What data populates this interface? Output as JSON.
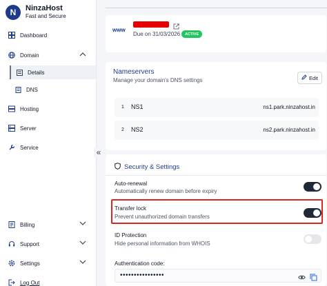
{
  "brand": {
    "logo_letter": "N",
    "name": "NinzaHost",
    "tagline": "Fast and Secure"
  },
  "sidebar": {
    "items": [
      {
        "label": "Dashboard"
      },
      {
        "label": "Domain"
      },
      {
        "label": "Hosting"
      },
      {
        "label": "Server"
      },
      {
        "label": "Service"
      },
      {
        "label": "Billing"
      },
      {
        "label": "Support"
      },
      {
        "label": "Settings"
      },
      {
        "label": "Log Out"
      }
    ],
    "domain_sub": [
      {
        "label": "Details"
      },
      {
        "label": "DNS"
      }
    ],
    "collapse_glyph": "«"
  },
  "domain": {
    "prefix": "www",
    "due": "Due on 31/03/2026",
    "status": "ACTIVE"
  },
  "nameservers": {
    "title": "Nameservers",
    "subtitle": "Manage your domain's DNS settings",
    "edit_label": "Edit",
    "rows": [
      {
        "num": "1",
        "label": "NS1",
        "value": "ns1.park.ninzahost.in"
      },
      {
        "num": "2",
        "label": "NS2",
        "value": "ns2.park.ninzahost.in"
      }
    ]
  },
  "security": {
    "title": "Security & Settings",
    "settings": [
      {
        "label": "Auto-renewal",
        "desc": "Automatically renew domain before expiry",
        "enabled": true
      },
      {
        "label": "Transfer lock",
        "desc": "Prevent unauthorized domain transfers",
        "enabled": true
      },
      {
        "label": "ID Protection",
        "desc": "Hide personal information from WHOIS",
        "enabled": false
      }
    ],
    "auth_label": "Authentication code:",
    "auth_masked": "••••••••••••••••"
  },
  "colors": {
    "brand": "#1e3a8a",
    "active_badge": "#22c55e",
    "highlight": "#dc2626",
    "redaction": "#e60000"
  },
  "icons": [
    "dashboard-icon",
    "globe-icon",
    "chevron-up-icon",
    "details-icon",
    "dns-icon",
    "hosting-icon",
    "server-icon",
    "service-icon",
    "billing-icon",
    "support-icon",
    "settings-icon",
    "logout-icon",
    "external-link-icon",
    "edit-icon",
    "shield-icon",
    "eye-icon",
    "copy-icon"
  ]
}
